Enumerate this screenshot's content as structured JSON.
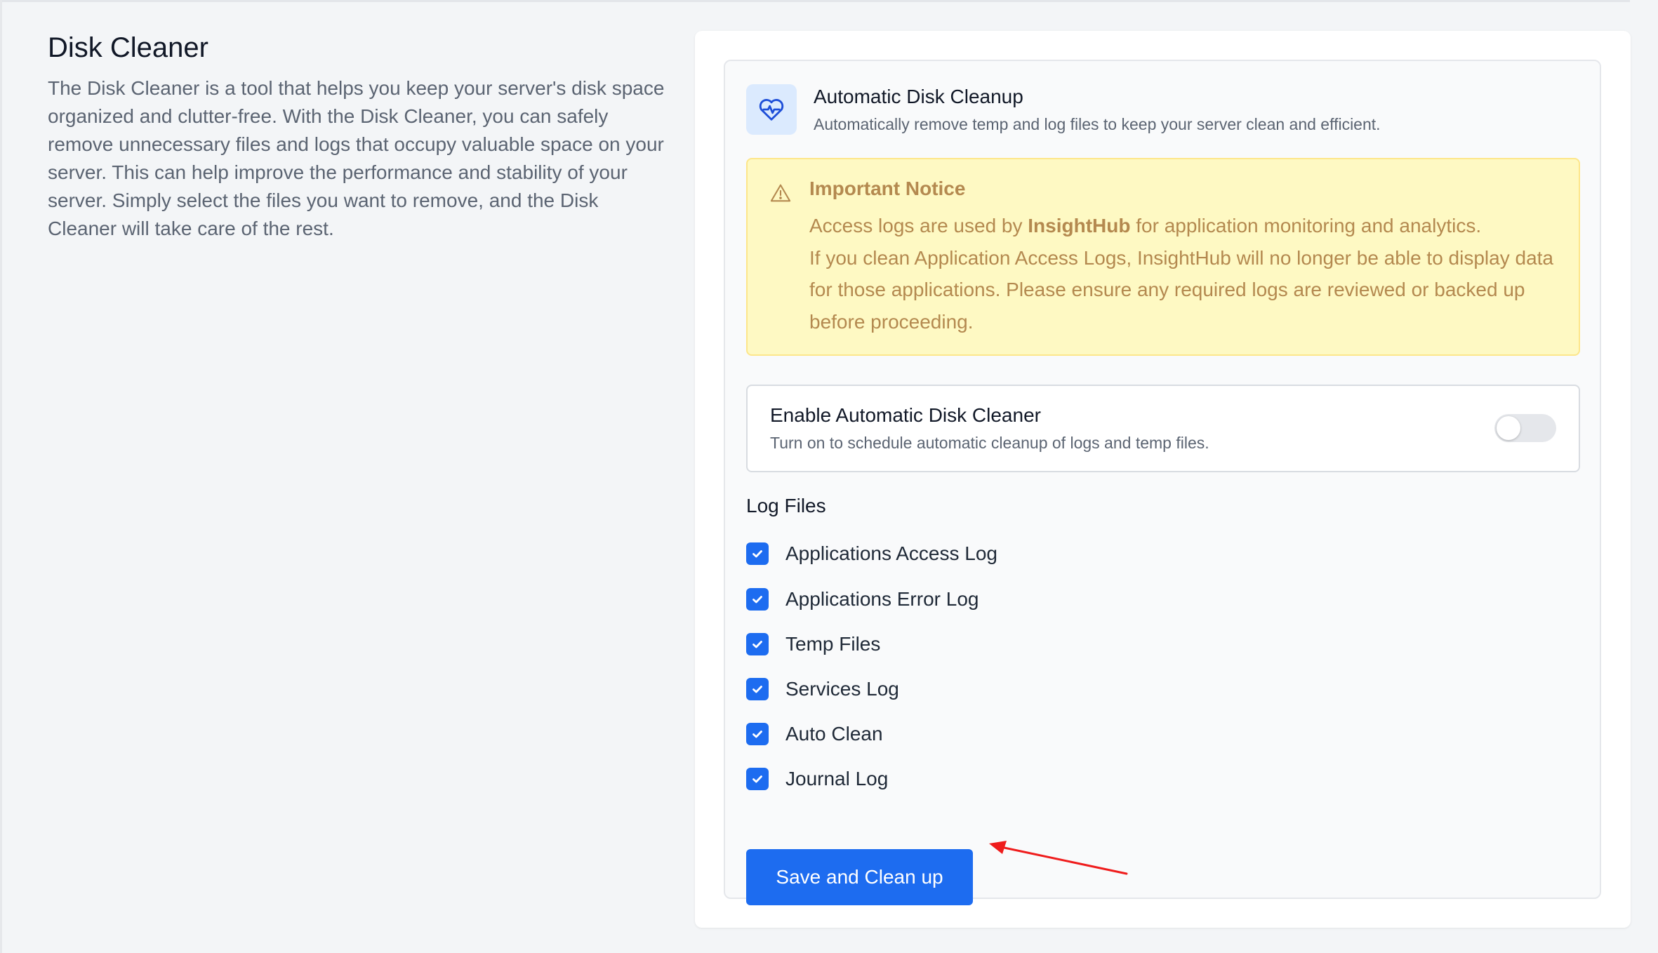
{
  "intro": {
    "title": "Disk Cleaner",
    "description": "The Disk Cleaner is a tool that helps you keep your server's disk space organized and clutter-free. With the Disk Cleaner, you can safely remove unnecessary files and logs that occupy valuable space on your server. This can help improve the performance and stability of your server. Simply select the files you want to remove, and the Disk Cleaner will take care of the rest."
  },
  "header": {
    "icon": "heart-pulse-icon",
    "title": "Automatic Disk Cleanup",
    "subtitle": "Automatically remove temp and log files to keep your server clean and efficient."
  },
  "notice": {
    "icon": "warning-triangle-icon",
    "title": "Important Notice",
    "line1_prefix": "Access logs are used by ",
    "line1_bold": "InsightHub",
    "line1_suffix": " for application monitoring and analytics.",
    "line2": "If you clean Application Access Logs, InsightHub will no longer be able to display data for those applications. Please ensure any required logs are reviewed or backed up before proceeding."
  },
  "auto_cleaner": {
    "title": "Enable Automatic Disk Cleaner",
    "subtitle": "Turn on to schedule automatic cleanup of logs and temp files.",
    "enabled": false
  },
  "log_files": {
    "heading": "Log Files",
    "items": [
      {
        "label": "Applications Access Log",
        "checked": true
      },
      {
        "label": "Applications Error Log",
        "checked": true
      },
      {
        "label": "Temp Files",
        "checked": true
      },
      {
        "label": "Services Log",
        "checked": true
      },
      {
        "label": "Auto Clean",
        "checked": true
      },
      {
        "label": "Journal Log",
        "checked": true
      }
    ]
  },
  "actions": {
    "save_label": "Save and Clean up"
  },
  "colors": {
    "primary": "#1d6cf0",
    "notice_text": "#b4894f",
    "notice_bg": "#fef9c3",
    "annotation_arrow": "#ef1c1c"
  }
}
